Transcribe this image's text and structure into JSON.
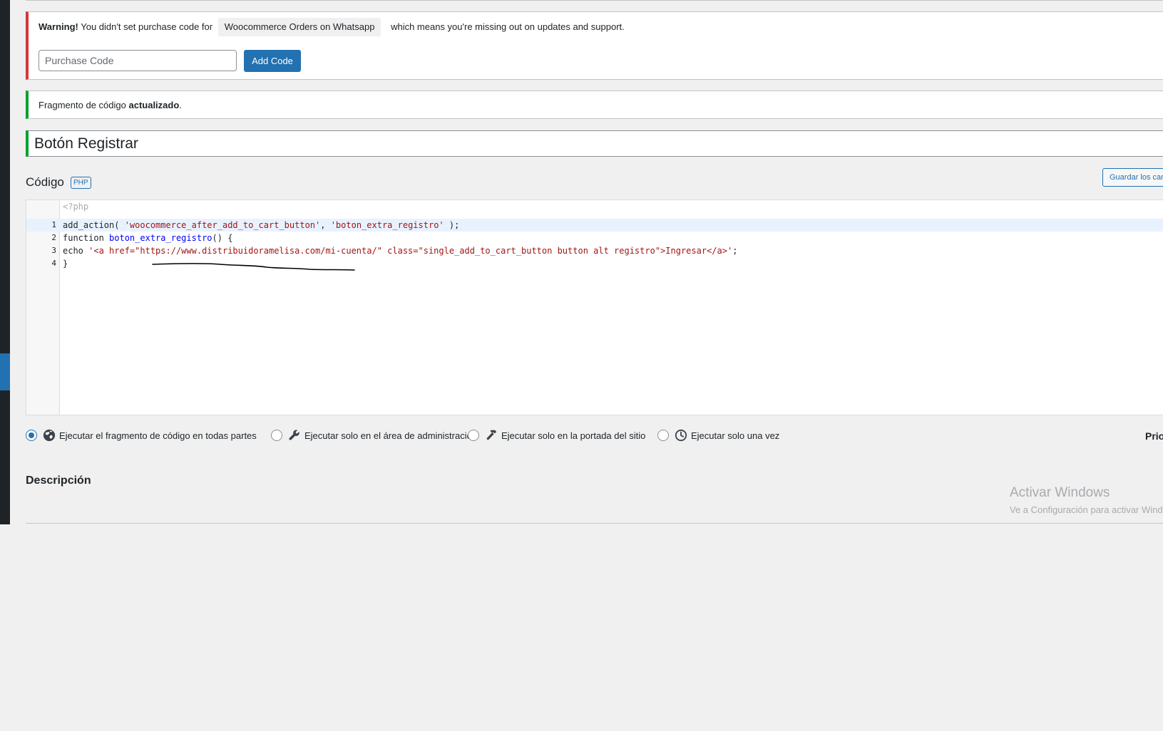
{
  "warning_notice": {
    "label": "Warning!",
    "text_before": "You didn't set purchase code for",
    "plugin_name": "Woocommerce Orders on Whatsapp",
    "text_after": "which means you're missing out on updates and support.",
    "input_placeholder": "Purchase Code",
    "button_label": "Add Code"
  },
  "success_notice": {
    "text": "Fragmento de código",
    "emphasis": "actualizado",
    "period": "."
  },
  "snippet": {
    "title": "Botón Registrar"
  },
  "code_section": {
    "heading": "Código",
    "badge": "PHP",
    "save_button": "Guardar los cambios"
  },
  "editor": {
    "header": "<?php",
    "lines": [
      {
        "number": "1",
        "tokens": [
          {
            "text": "add_action( ",
            "type": "fn"
          },
          {
            "text": "'woocommerce_after_add_to_cart_button'",
            "type": "str"
          },
          {
            "text": ", ",
            "type": "p"
          },
          {
            "text": "'boton_extra_registro'",
            "type": "str"
          },
          {
            "text": " );",
            "type": "p"
          }
        ]
      },
      {
        "number": "2",
        "tokens": [
          {
            "text": "function ",
            "type": "kw"
          },
          {
            "text": "boton_extra_registro",
            "type": "def"
          },
          {
            "text": "() {",
            "type": "p"
          }
        ]
      },
      {
        "number": "3",
        "tokens": [
          {
            "text": "echo ",
            "type": "kw"
          },
          {
            "text": "'<a href=\"https://www.distribuidoramelisa.com/mi-cuenta/\" class=\"single_add_to_cart_button button alt registro\">Ingresar</a>'",
            "type": "str"
          },
          {
            "text": ";",
            "type": "p"
          }
        ]
      },
      {
        "number": "4",
        "tokens": [
          {
            "text": "}",
            "type": "p"
          }
        ]
      }
    ]
  },
  "scope_options": {
    "everywhere": "Ejecutar el fragmento de código en todas partes",
    "admin": "Ejecutar solo en el área de administración",
    "frontend": "Ejecutar solo en la portada del sitio",
    "once": "Ejecutar solo una vez",
    "selected": "everywhere"
  },
  "priority": {
    "label": "Prioridad"
  },
  "description": {
    "heading": "Descripción"
  },
  "windows_watermark": {
    "title": "Activar Windows",
    "subtitle": "Ve a Configuración para activar Windows."
  },
  "colors": {
    "accent": "#2271b1",
    "error": "#d63638",
    "success": "#00a32a",
    "admin_bar": "#1d2327"
  },
  "icons": {
    "rail": "chevron-left-icon",
    "everywhere": "globe-icon",
    "admin": "wrench-icon",
    "frontend": "hammer-icon",
    "once": "clock-icon"
  }
}
